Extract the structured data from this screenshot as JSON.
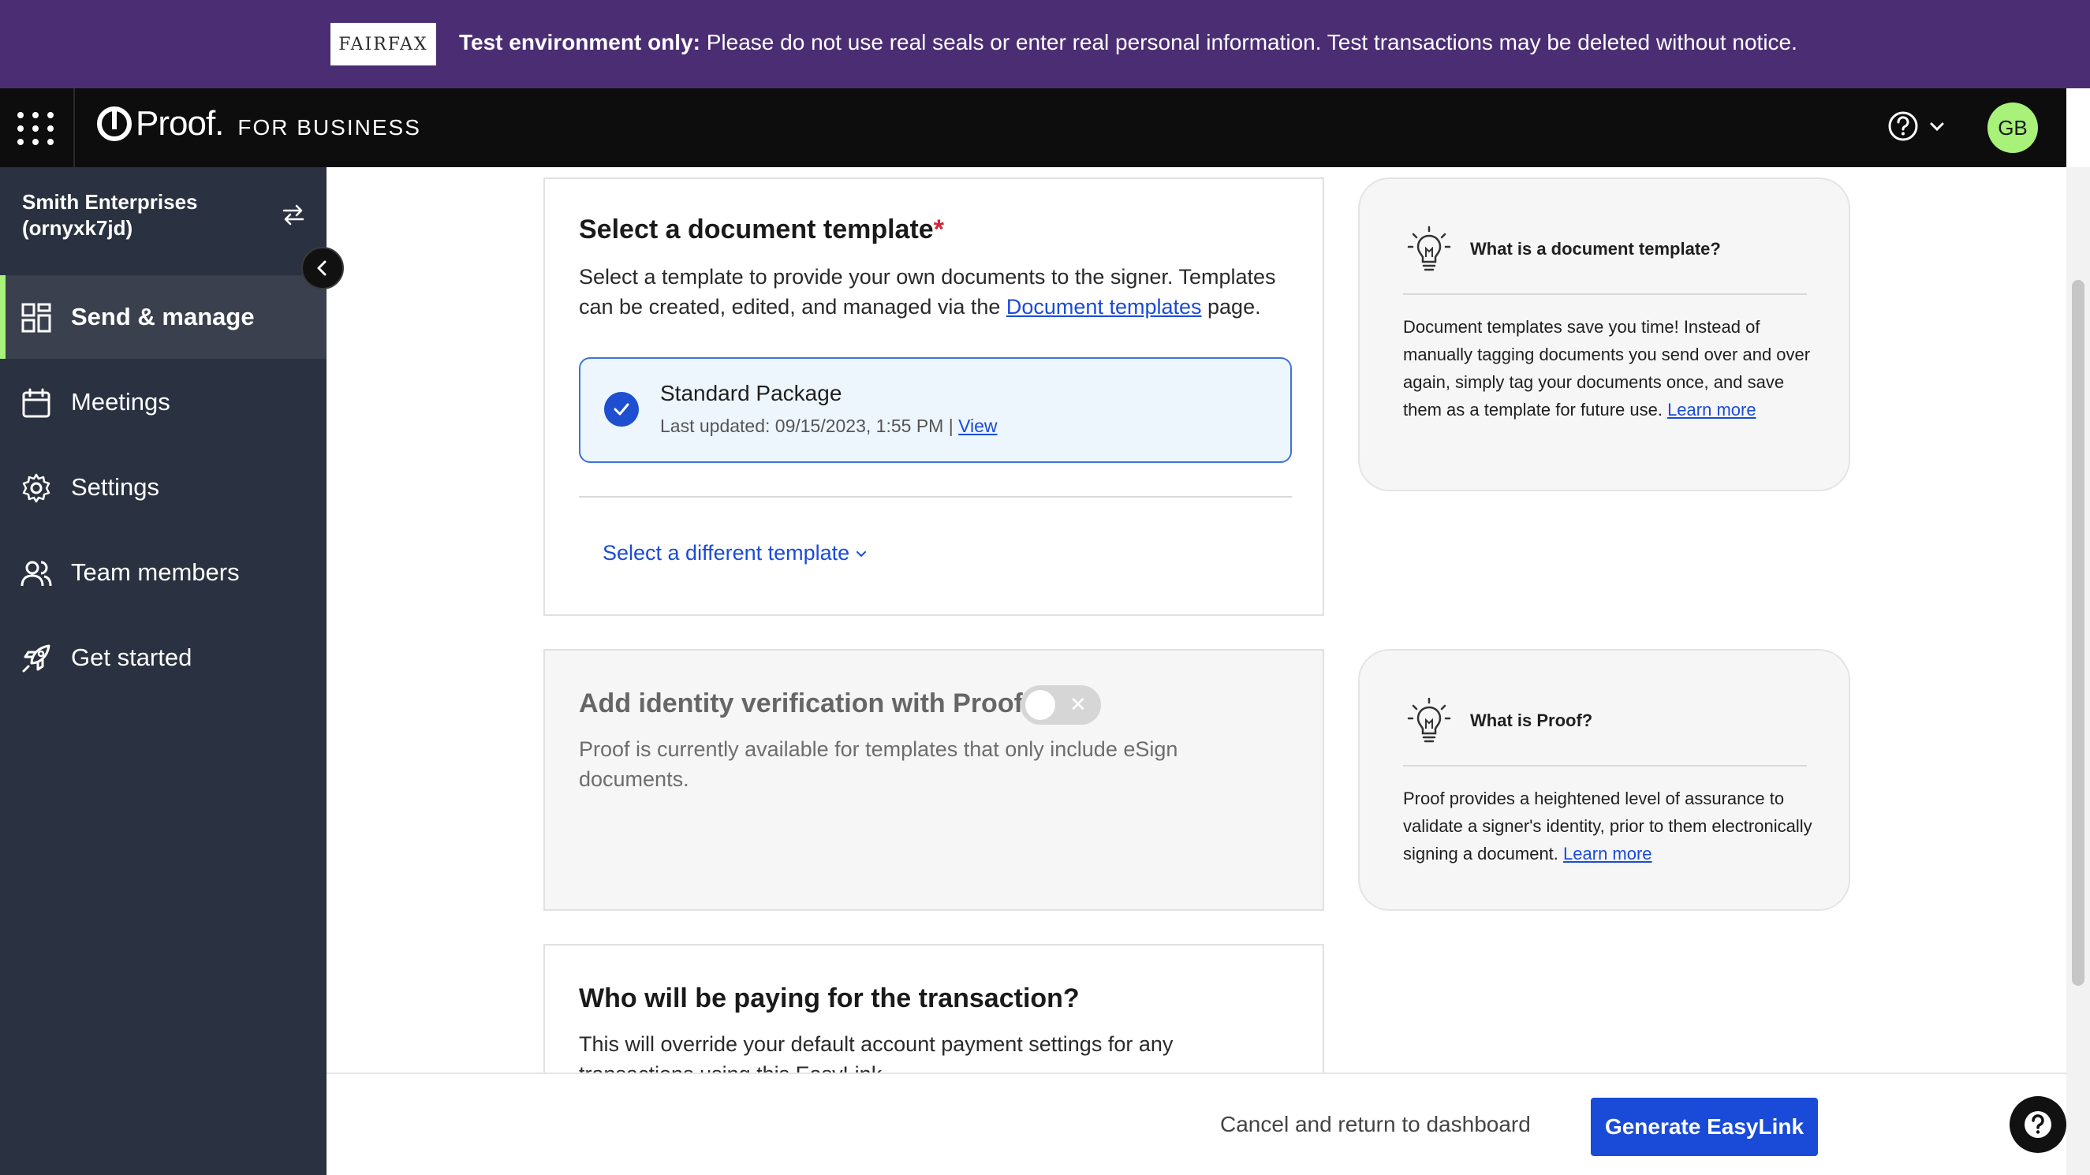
{
  "banner": {
    "logo_text": "FAIRFAX",
    "bold_text": "Test environment only:",
    "message": " Please do not use real seals or enter real personal information. Test transactions may be deleted without notice."
  },
  "header": {
    "brand_name": "Proof.",
    "brand_sub": "FOR BUSINESS",
    "avatar_initials": "GB"
  },
  "sidebar": {
    "org_name": "Smith Enterprises",
    "org_id": "(ornyxk7jd)",
    "items": [
      {
        "label": "Send & manage",
        "icon": "dashboard-icon",
        "active": true
      },
      {
        "label": "Meetings",
        "icon": "calendar-icon",
        "active": false
      },
      {
        "label": "Settings",
        "icon": "gear-icon",
        "active": false
      },
      {
        "label": "Team members",
        "icon": "team-icon",
        "active": false
      },
      {
        "label": "Get started",
        "icon": "rocket-icon",
        "active": false
      }
    ]
  },
  "template_section": {
    "title": "Select a document template",
    "required_mark": "*",
    "desc_before": "Select a template to provide your own documents to the signer. Templates can be created, edited, and managed via the ",
    "desc_link": "Document templates",
    "desc_after": " page.",
    "selected_template": {
      "name": "Standard Package",
      "meta": "Last updated: 09/15/2023, 1:55 PM | ",
      "view_link": "View"
    },
    "change_label": "Select a different template"
  },
  "identity_section": {
    "title": "Add identity verification with Proof",
    "toggle_off_glyph": "✕",
    "desc": "Proof is currently available for templates that only include eSign documents."
  },
  "payment_section": {
    "title": "Who will be paying for the transaction?",
    "desc": "This will override your default account payment settings for any transactions using this EasyLink."
  },
  "info_cards": [
    {
      "title": "What is a document template?",
      "body": "Document templates save you time! Instead of manually tagging documents you send over and over again, simply tag your documents once, and save them as a template for future use. ",
      "link": "Learn more"
    },
    {
      "title": "What is Proof?",
      "body": "Proof provides a heightened level of assurance to validate a signer's identity, prior to them electronically signing a document. ",
      "link": "Learn more"
    }
  ],
  "footer": {
    "cancel_label": "Cancel and return to dashboard",
    "primary_label": "Generate EasyLink"
  },
  "colors": {
    "banner_bg": "#4b2d73",
    "nav_bg": "#0d0d0d",
    "sidebar_bg": "#2a3140",
    "accent_green": "#a8f27a",
    "primary_blue": "#1a4bd8"
  }
}
